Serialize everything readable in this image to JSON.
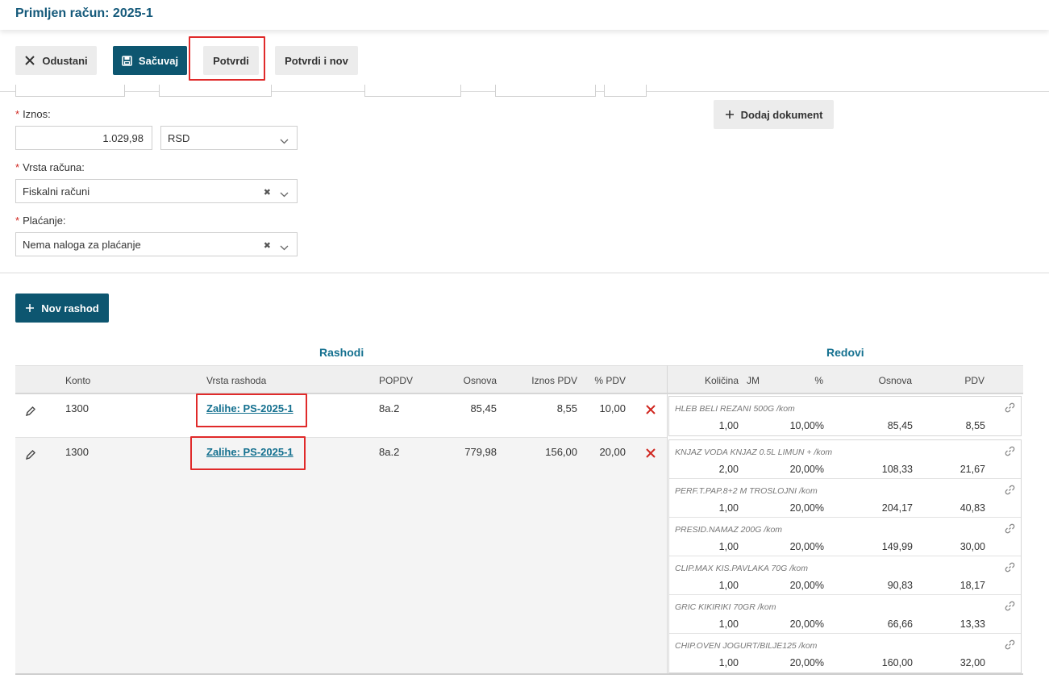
{
  "header": {
    "title": "Primljen račun: 2025-1"
  },
  "toolbar": {
    "cancel_label": "Odustani",
    "save_label": "Sačuvaj",
    "confirm_label": "Potvrdi",
    "confirm_new_label": "Potvrdi i nov"
  },
  "form": {
    "amount_label": "Iznos:",
    "amount_value": "1.029,98",
    "currency_value": "RSD",
    "invoice_type_label": "Vrsta računa:",
    "invoice_type_value": "Fiskalni računi",
    "payment_label": "Plaćanje:",
    "payment_value": "Nema naloga za plaćanje",
    "add_document_label": "Dodaj dokument"
  },
  "new_expense_label": "Nov rashod",
  "sections": {
    "expenses_title": "Rashodi",
    "lines_title": "Redovi"
  },
  "columns": {
    "konto": "Konto",
    "type": "Vrsta rashoda",
    "popdv": "POPDV",
    "base": "Osnova",
    "vat_amount": "Iznos PDV",
    "vat_pct": "% PDV",
    "qty": "Količina",
    "unit": "JM",
    "pct": "%",
    "line_base": "Osnova",
    "line_vat": "PDV"
  },
  "expenses": [
    {
      "konto": "1300",
      "type": "Zalihe: PS-2025-1",
      "popdv": "8a.2",
      "base": "85,45",
      "vat_amount": "8,55",
      "vat_pct": "10,00"
    },
    {
      "konto": "1300",
      "type": "Zalihe: PS-2025-1",
      "popdv": "8a.2",
      "base": "779,98",
      "vat_amount": "156,00",
      "vat_pct": "20,00"
    }
  ],
  "lines": [
    {
      "name": "HLEB BELI REZANI 500G /kom",
      "qty": "1,00",
      "pct": "10,00%",
      "base": "85,45",
      "vat": "8,55"
    },
    {
      "name": "KNJAZ VODA KNJAZ 0.5L LIMUN + /kom",
      "qty": "2,00",
      "pct": "20,00%",
      "base": "108,33",
      "vat": "21,67"
    },
    {
      "name": "PERF.T.PAP.8+2 M TROSLOJNI /kom",
      "qty": "1,00",
      "pct": "20,00%",
      "base": "204,17",
      "vat": "40,83"
    },
    {
      "name": "PRESID.NAMAZ 200G /kom",
      "qty": "1,00",
      "pct": "20,00%",
      "base": "149,99",
      "vat": "30,00"
    },
    {
      "name": "CLIP.MAX KIS.PAVLAKA 70G /kom",
      "qty": "1,00",
      "pct": "20,00%",
      "base": "90,83",
      "vat": "18,17"
    },
    {
      "name": "GRIC KIKIRIKI 70GR /kom",
      "qty": "1,00",
      "pct": "20,00%",
      "base": "66,66",
      "vat": "13,33"
    },
    {
      "name": "CHIP.OVEN JOGURT/BILJE125 /kom",
      "qty": "1,00",
      "pct": "20,00%",
      "base": "160,00",
      "vat": "32,00"
    }
  ],
  "colors": {
    "primary": "#0d5670",
    "accent_text": "#14708f",
    "highlight": "#e02a2a",
    "delete": "#d0261f"
  }
}
